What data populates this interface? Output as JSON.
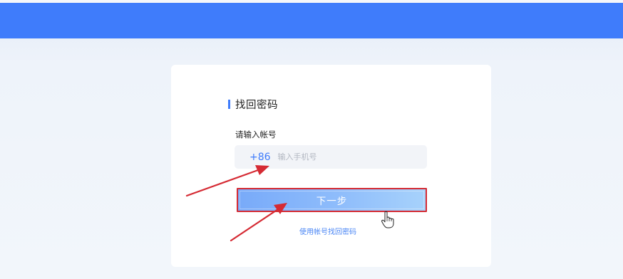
{
  "title": "找回密码",
  "account_label": "请输入帐号",
  "phone": {
    "country_code": "+86",
    "placeholder": "输入手机号",
    "value": ""
  },
  "next_button": "下一步",
  "alt_link": "使用帐号找回密码",
  "colors": {
    "brand": "#3f7cfb",
    "annotation": "#d52a33"
  },
  "icons": {
    "cursor": "hand-pointer-icon"
  }
}
